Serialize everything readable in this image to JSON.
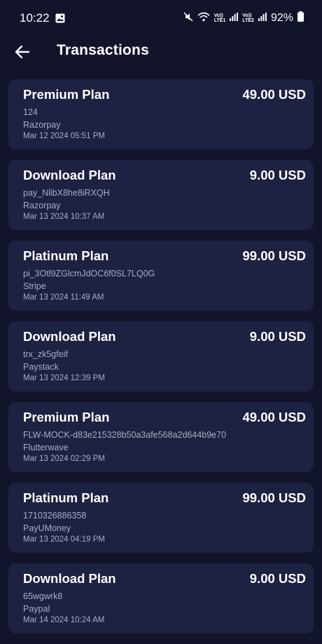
{
  "status_bar": {
    "time": "10:22",
    "battery": "92%",
    "sim1": "LTE1",
    "sim2": "LTE2",
    "icons": [
      "gallery-icon",
      "mute-icon",
      "wifi-icon",
      "signal-icon",
      "battery-icon"
    ]
  },
  "header": {
    "title": "Transactions"
  },
  "transactions": [
    {
      "plan": "Premium Plan",
      "amount": "49.00 USD",
      "ref": "124",
      "gateway": "Razorpay",
      "date": "Mar 12 2024 05:51 PM"
    },
    {
      "plan": "Download Plan",
      "amount": "9.00 USD",
      "ref": "pay_NlibX8he8iRXQH",
      "gateway": "Razorpay",
      "date": "Mar 13 2024 10:37 AM"
    },
    {
      "plan": "Platinum Plan",
      "amount": "99.00 USD",
      "ref": "pi_3Otl9ZGlcmJdOC6f0SL7LQ0G",
      "gateway": "Stripe",
      "date": "Mar 13 2024 11:49 AM"
    },
    {
      "plan": "Download Plan",
      "amount": "9.00 USD",
      "ref": "trx_zk5gfeif",
      "gateway": "Paystack",
      "date": "Mar 13 2024 12:39 PM"
    },
    {
      "plan": "Premium Plan",
      "amount": "49.00 USD",
      "ref": "FLW-MOCK-d83e215328b50a3afe568a2d644b9e70",
      "gateway": "Flutterwave",
      "date": "Mar 13 2024 02:29 PM"
    },
    {
      "plan": "Platinum Plan",
      "amount": "99.00 USD",
      "ref": "1710326886358",
      "gateway": "PayUMoney",
      "date": "Mar 13 2024 04:19 PM"
    },
    {
      "plan": "Download Plan",
      "amount": "9.00 USD",
      "ref": "65wgwrk8",
      "gateway": "Paypal",
      "date": "Mar 14 2024 10:24 AM"
    }
  ],
  "colors": {
    "background": "#11142b",
    "card": "#1d2142",
    "secondary_text": "#a9adc4"
  }
}
